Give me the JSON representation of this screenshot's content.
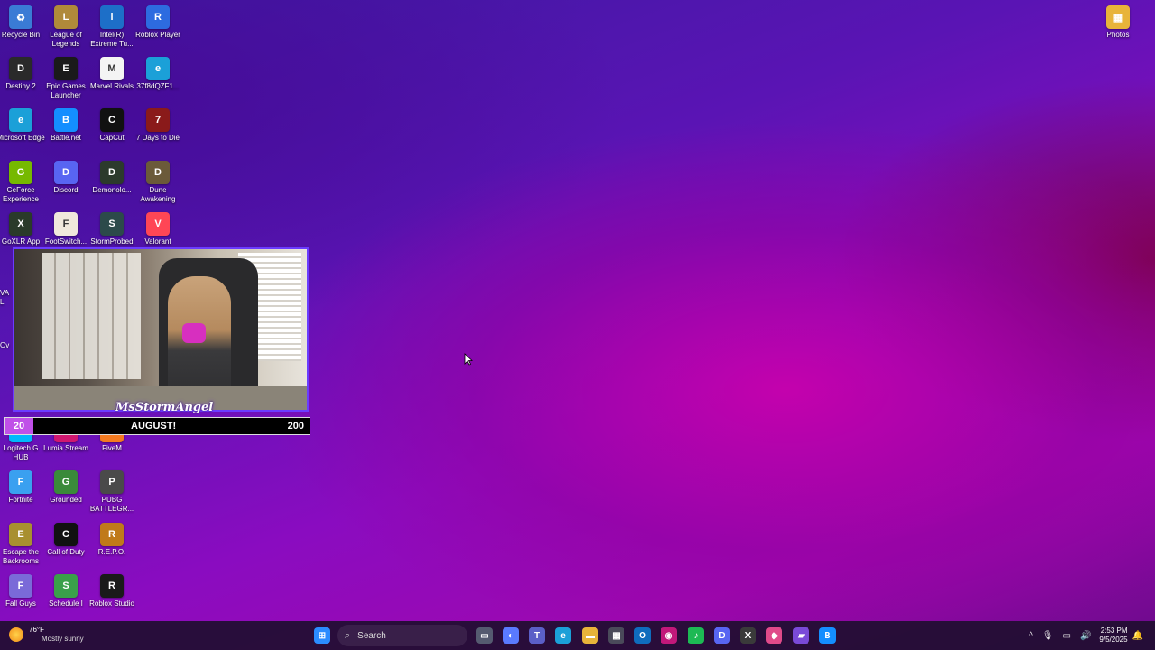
{
  "desktop": {
    "icons": [
      {
        "label": "Recycle Bin",
        "glyph": "♻",
        "color": "#3a7bd5",
        "icon": "recycle-bin-icon"
      },
      {
        "label": "League of Legends",
        "glyph": "L",
        "color": "#b08a3a",
        "icon": "league-icon"
      },
      {
        "label": "Intel(R) Extreme Tu...",
        "glyph": "i",
        "color": "#1d6fc8",
        "icon": "intel-icon"
      },
      {
        "label": "Roblox Player",
        "glyph": "R",
        "color": "#2d6be0",
        "icon": "roblox-icon"
      },
      {
        "label": "Destiny 2",
        "glyph": "D",
        "color": "#2a2a2a",
        "icon": "destiny-icon"
      },
      {
        "label": "Epic Games Launcher",
        "glyph": "E",
        "color": "#1a1a1a",
        "icon": "epic-games-icon"
      },
      {
        "label": "Marvel Rivals",
        "glyph": "M",
        "color": "#f4f4f4",
        "icon": "file-icon"
      },
      {
        "label": "37f8dQZF1...",
        "glyph": "e",
        "color": "#1ba0d8",
        "icon": "edge-file-icon"
      },
      {
        "label": "Microsoft Edge",
        "glyph": "e",
        "color": "#1ba0d8",
        "icon": "edge-icon"
      },
      {
        "label": "Battle.net",
        "glyph": "B",
        "color": "#148eff",
        "icon": "battlenet-icon"
      },
      {
        "label": "CapCut",
        "glyph": "C",
        "color": "#111111",
        "icon": "capcut-icon"
      },
      {
        "label": "7 Days to Die",
        "glyph": "7",
        "color": "#8a1a1a",
        "icon": "seven-days-icon"
      },
      {
        "label": "GeForce Experience",
        "glyph": "G",
        "color": "#76b900",
        "icon": "geforce-icon"
      },
      {
        "label": "Discord",
        "glyph": "D",
        "color": "#5865f2",
        "icon": "discord-icon"
      },
      {
        "label": "Demonolo...",
        "glyph": "D",
        "color": "#2c3a2c",
        "icon": "demonologist-icon"
      },
      {
        "label": "Dune Awakening",
        "glyph": "D",
        "color": "#6b5a3a",
        "icon": "dune-icon"
      },
      {
        "label": "GoXLR App",
        "glyph": "X",
        "color": "#2a3a2a",
        "icon": "goxlr-icon"
      },
      {
        "label": "FootSwitch...",
        "glyph": "F",
        "color": "#f0e8dc",
        "icon": "footswitch-icon"
      },
      {
        "label": "StormProbed",
        "glyph": "S",
        "color": "#2c4a4a",
        "icon": "stormprobed-icon"
      },
      {
        "label": "Valorant",
        "glyph": "V",
        "color": "#ff4655",
        "icon": "valorant-icon"
      },
      {
        "label": "Logitech G HUB",
        "glyph": "G",
        "color": "#00b8fc",
        "icon": "logitech-icon"
      },
      {
        "label": "Lumia Stream",
        "glyph": "@",
        "color": "#d01870",
        "icon": "lumia-icon"
      },
      {
        "label": "FiveM",
        "glyph": "5",
        "color": "#f47a20",
        "icon": "fivem-icon"
      },
      {
        "label": "Fortnite",
        "glyph": "F",
        "color": "#3aa0f0",
        "icon": "fortnite-icon"
      },
      {
        "label": "Grounded",
        "glyph": "G",
        "color": "#3a8a3a",
        "icon": "grounded-icon"
      },
      {
        "label": "PUBG BATTLEGR...",
        "glyph": "P",
        "color": "#4a4a4a",
        "icon": "pubg-icon"
      },
      {
        "label": "Escape the Backrooms",
        "glyph": "E",
        "color": "#a89030",
        "icon": "backrooms-icon"
      },
      {
        "label": "Call of Duty",
        "glyph": "C",
        "color": "#111111",
        "icon": "cod-icon"
      },
      {
        "label": "R.E.P.O.",
        "glyph": "R",
        "color": "#c07a1a",
        "icon": "repo-icon"
      },
      {
        "label": "Fall Guys",
        "glyph": "F",
        "color": "#7a6ad8",
        "icon": "fallguys-icon"
      },
      {
        "label": "Schedule I",
        "glyph": "S",
        "color": "#3aa04a",
        "icon": "schedule-icon"
      },
      {
        "label": "Roblox Studio",
        "glyph": "R",
        "color": "#1a1a1a",
        "icon": "roblox-studio-icon"
      },
      {
        "label": "Photos",
        "glyph": "▦",
        "color": "#e8b43a",
        "icon": "photos-folder-icon"
      }
    ],
    "partial_labels": [
      "VAL",
      "Ov"
    ]
  },
  "overlay": {
    "streamer_name": "MsStormAngel",
    "goal_current": "20",
    "goal_title": "AUGUST!",
    "goal_target": "200"
  },
  "taskbar": {
    "weather_temp": "76°F",
    "weather_condition": "Mostly sunny",
    "search_placeholder": "Search",
    "time": "2:53 PM",
    "date": "9/5/2025",
    "apps": [
      {
        "name": "start-button",
        "glyph": "⊞",
        "color": "#2b8cff"
      },
      {
        "name": "taskview-icon",
        "glyph": "▭",
        "color": "#555a70"
      },
      {
        "name": "copilot-icon",
        "glyph": "◐",
        "color": "#5a7aff"
      },
      {
        "name": "teams-icon",
        "glyph": "T",
        "color": "#5b5fc7"
      },
      {
        "name": "edge-taskbar-icon",
        "glyph": "e",
        "color": "#1ba0d8"
      },
      {
        "name": "file-explorer-icon",
        "glyph": "▬",
        "color": "#e8b43a"
      },
      {
        "name": "store-icon",
        "glyph": "▦",
        "color": "#4a4a5a"
      },
      {
        "name": "outlook-icon",
        "glyph": "O",
        "color": "#0f6cbd"
      },
      {
        "name": "lumia-taskbar-icon",
        "glyph": "◉",
        "color": "#c2187a"
      },
      {
        "name": "spotify-icon",
        "glyph": "♪",
        "color": "#1db954"
      },
      {
        "name": "discord-taskbar-icon",
        "glyph": "D",
        "color": "#5865f2"
      },
      {
        "name": "xbox-icon",
        "glyph": "X",
        "color": "#3a3a3a"
      },
      {
        "name": "colorful-app-icon",
        "glyph": "◆",
        "color": "#e04a8a"
      },
      {
        "name": "clapper-icon",
        "glyph": "▰",
        "color": "#7a4ad8"
      },
      {
        "name": "battlenet-taskbar-icon",
        "glyph": "B",
        "color": "#148eff"
      }
    ],
    "tray": [
      "^",
      "🎙",
      "▭",
      "🔊"
    ]
  }
}
